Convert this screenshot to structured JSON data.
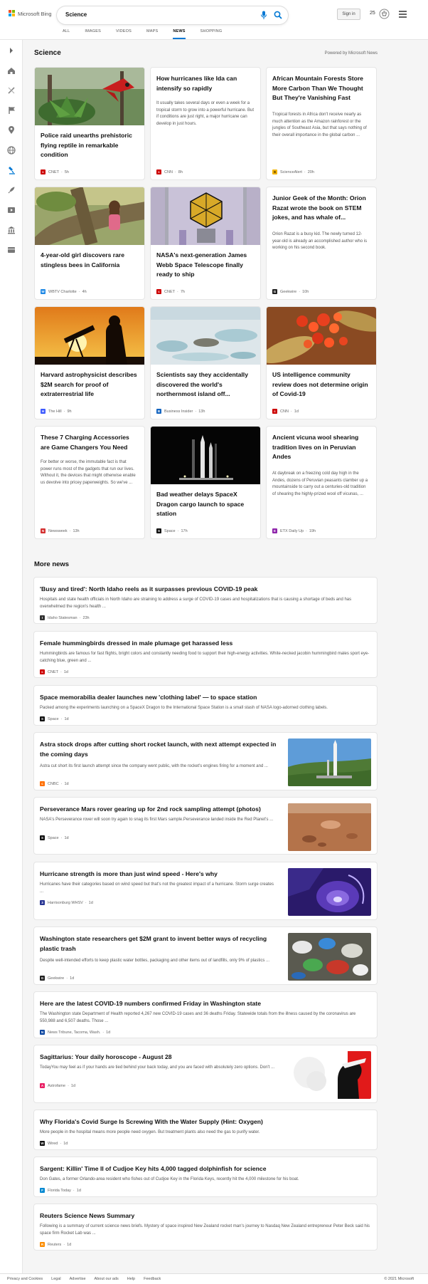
{
  "header": {
    "brand": "Microsoft Bing",
    "brand_colors": [
      "#f25022",
      "#7fba00",
      "#00a4ef",
      "#ffb900"
    ],
    "query": "Science",
    "signin_label": "Sign in",
    "rewards_count": "25",
    "scopes": [
      "ALL",
      "IMAGES",
      "VIDEOS",
      "MAPS",
      "NEWS",
      "SHOPPING"
    ],
    "active_scope": "NEWS",
    "accent": "#0078d4"
  },
  "rail": {
    "icons": [
      "chevron-right-icon",
      "home-icon",
      "sports-icon",
      "flag-icon",
      "location-icon",
      "globe-icon",
      "science-icon",
      "rocket-icon",
      "video-icon",
      "bank-icon",
      "card-icon"
    ]
  },
  "section": {
    "title": "Science",
    "powered_by": "Powered by Microsoft News"
  },
  "cards": [
    {
      "title": "Police raid unearths prehistoric flying reptile in remarkable condition",
      "source": "CNET",
      "time": "5h"
    },
    {
      "title": "How hurricanes like Ida can intensify so rapidly",
      "snippet": "It usually takes several days or even a week for a tropical storm to grow into a powerful hurricane. But if conditions are just right, a major hurricane can develop in just hours.",
      "source": "CNN",
      "time": "8h"
    },
    {
      "title": "African Mountain Forests Store More Carbon Than We Thought But They're Vanishing Fast",
      "snippet": "Tropical forests in Africa don't receive nearly as much attention as the Amazon rainforest or the jungles of Southeast Asia, but that says nothing of their overall importance in the global carbon ...",
      "source": "ScienceAlert",
      "time": "20h"
    },
    {
      "title": "4-year-old girl discovers rare stingless bees in California",
      "source": "WBTV Charlotte",
      "time": "4h"
    },
    {
      "title": "NASA's next-generation James Webb Space Telescope finally ready to ship",
      "source": "CNET",
      "time": "7h"
    },
    {
      "title": "Junior Geek of the Month: Orion Razat wrote the book on STEM jokes, and has whale of...",
      "snippet": "Orion Razat is a busy kid. The newly turned 12-year-old is already an accomplished author who is working on his second book.",
      "source": "Geekwire",
      "time": "10h"
    },
    {
      "title": "Harvard astrophysicist describes $2M search for proof of extraterrestrial life",
      "source": "The Hill",
      "time": "9h"
    },
    {
      "title": "Scientists say they accidentally discovered the world's northernmost island off...",
      "source": "Business Insider",
      "time": "13h"
    },
    {
      "title": "US intelligence community review does not determine origin of Covid-19",
      "source": "CNN",
      "time": "1d"
    },
    {
      "title": "These 7 Charging Accessories are Game Changers You Need",
      "snippet": "For better or worse, the immutable fact is that power runs most of the gadgets that run our lives. Without it, the devices that might otherwise enable us devolve into pricey paperweights. So we've ...",
      "source": "Newsweek",
      "time": "13h"
    },
    {
      "title": "Bad weather delays SpaceX Dragon cargo launch to space station",
      "source": "Space",
      "time": "17h"
    },
    {
      "title": "Ancient vicuna wool shearing tradition lives on in Peruvian Andes",
      "snippet": "At daybreak on a freezing cold day high in the Andes, dozens of Peruvian peasants clamber up a mountainside to carry out a centuries-old tradition of shearing the highly-prized wool off vicunas, ...",
      "source": "ETX Daily Up",
      "time": "19h"
    }
  ],
  "more_news": {
    "title": "More news",
    "items": [
      {
        "title": "'Busy and tired': North Idaho reels as it surpasses previous COVID-19 peak",
        "snippet": "Hospitals and state health officials in North Idaho are straining to address a surge of COVID-19 cases and hospitalizations that is causing a shortage of beds and has overwhelmed the region's health ...",
        "source": "Idaho Statesman",
        "time": "23h"
      },
      {
        "title": "Female hummingbirds dressed in male plumage get harassed less",
        "snippet": "Hummingbirds are famous for fast flights, bright colors and constantly needing food to support their high-energy activities. White-necked jacobin hummingbird males sport eye-catching blue, green and ...",
        "source": "CNET",
        "time": "1d"
      },
      {
        "title": "Space memorabilia dealer launches new 'clothing label' — to space station",
        "snippet": "Packed among the experiments launching on a SpaceX Dragon to the International Space Station is a small stash of NASA logo-adorned clothing labels.",
        "source": "Space",
        "time": "1d"
      },
      {
        "title": "Astra stock drops after cutting short rocket launch, with next attempt expected in the coming days",
        "snippet": "Astra cut short its first launch attempt since the company went public, with the rocket's engines firing for a moment and ...",
        "source": "CNBC",
        "time": "1d"
      },
      {
        "title": "Perseverance Mars rover gearing up for 2nd rock sampling attempt (photos)",
        "snippet": "NASA's Perseverance rover will soon try again to snag its first Mars sample.Perseverance landed inside the Red Planet's ...",
        "source": "Space",
        "time": "1d"
      },
      {
        "title": "Hurricane strength is more than just wind speed - Here's why",
        "snippet": "Hurricanes have their categories based on wind speed but that's not the greatest impact of a hurricane. Storm surge creates ...",
        "source": "Harrisonburg WHSV",
        "time": "1d"
      },
      {
        "title": "Washington state researchers get $2M grant to invent better ways of recycling plastic trash",
        "snippet": "Despite well-intended efforts to keep plastic water bottles, packaging and other items out of landfills, only 9% of plastics ...",
        "source": "Geekwire",
        "time": "1d"
      },
      {
        "title": "Here are the latest COVID-19 numbers confirmed Friday in Washington state",
        "snippet": "The Washington state Department of Health reported 4,267 new COVID-19 cases and 36 deaths Friday. Statewide totals from the illness caused by the coronavirus are 550,988 and 6,507 deaths. Those ...",
        "source": "News Tribune, Tacoma, Wash.",
        "time": "1d"
      },
      {
        "title": "Sagittarius: Your daily horoscope - August 28",
        "snippet": "TodayYou may feel as if your hands are tied behind your back today, and you are faced with absolutely zero options. Don't ...",
        "source": "Astrofame",
        "time": "1d"
      },
      {
        "title": "Why Florida's Covid Surge Is Screwing With the Water Supply (Hint: Oxygen)",
        "snippet": "More people in the hospital means more people need oxygen. But treatment plants also need the gas to purify water.",
        "source": "Wired",
        "time": "1d"
      },
      {
        "title": "Sargent: Killin' Time II of Cudjoe Key hits 4,000 tagged dolphinfish for science",
        "snippet": "Don Gates, a former Orlando-area resident who fishes out of Cudjoe Key in the Florida Keys, recently hit the 4,000 milestone for his boat.",
        "source": "Florida Today",
        "time": "1d"
      },
      {
        "title": "Reuters Science News Summary",
        "snippet": "Following is a summary of current science news briefs. Mystery of space inspired New Zealand rocket man's journey to Nasdaq New Zealand entrepreneur Peter Beck said his space firm Rocket Lab was ...",
        "source": "Reuters",
        "time": "1d"
      }
    ]
  },
  "footer": {
    "links": [
      "Privacy and Cookies",
      "Legal",
      "Advertise",
      "About our ads",
      "Help",
      "Feedback"
    ],
    "copyright": "© 2021 Microsoft"
  }
}
